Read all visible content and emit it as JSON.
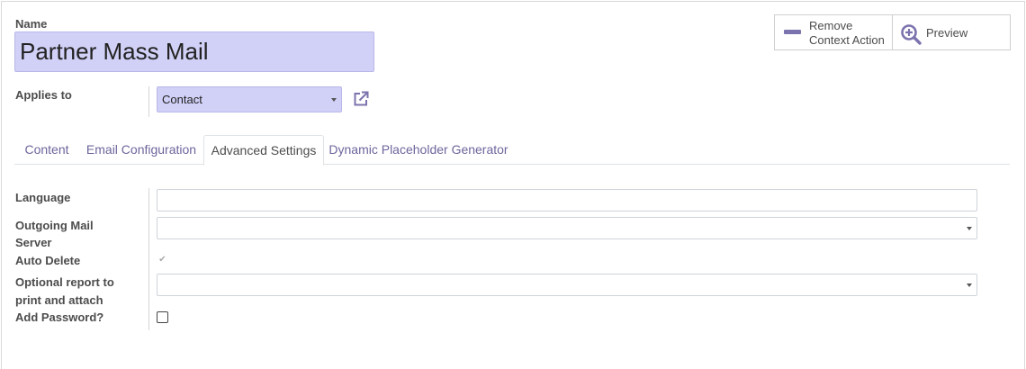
{
  "form": {
    "name_label": "Name",
    "name_value": "Partner Mass Mail",
    "applies_to_label": "Applies to",
    "applies_to_value": "Contact"
  },
  "smart_buttons": {
    "remove_line1": "Remove",
    "remove_line2": "Context Action",
    "preview": "Preview"
  },
  "tabs": [
    {
      "label": "Content",
      "active": false
    },
    {
      "label": "Email Configuration",
      "active": false
    },
    {
      "label": "Advanced Settings",
      "active": true
    },
    {
      "label": "Dynamic Placeholder Generator",
      "active": false
    }
  ],
  "advanced": {
    "language_label": "Language",
    "language_value": "",
    "mail_server_label_line1": "Outgoing Mail",
    "mail_server_label_line2": "Server",
    "mail_server_value": "",
    "auto_delete_label": "Auto Delete",
    "auto_delete_checked": true,
    "report_label_line1": "Optional report to",
    "report_label_line2": "print and attach",
    "report_value": "",
    "add_password_label": "Add Password?",
    "add_password_checked": false
  },
  "icons": {
    "remove": "minus-icon",
    "preview": "zoom-in-icon",
    "external_link": "external-link-icon",
    "dropdown": "caret-down-icon",
    "checkmark": "checkmark-icon"
  },
  "colors": {
    "accent": "#7b73ad",
    "required_field_bg": "#d1d0f7",
    "tab_link": "#6c669c"
  }
}
